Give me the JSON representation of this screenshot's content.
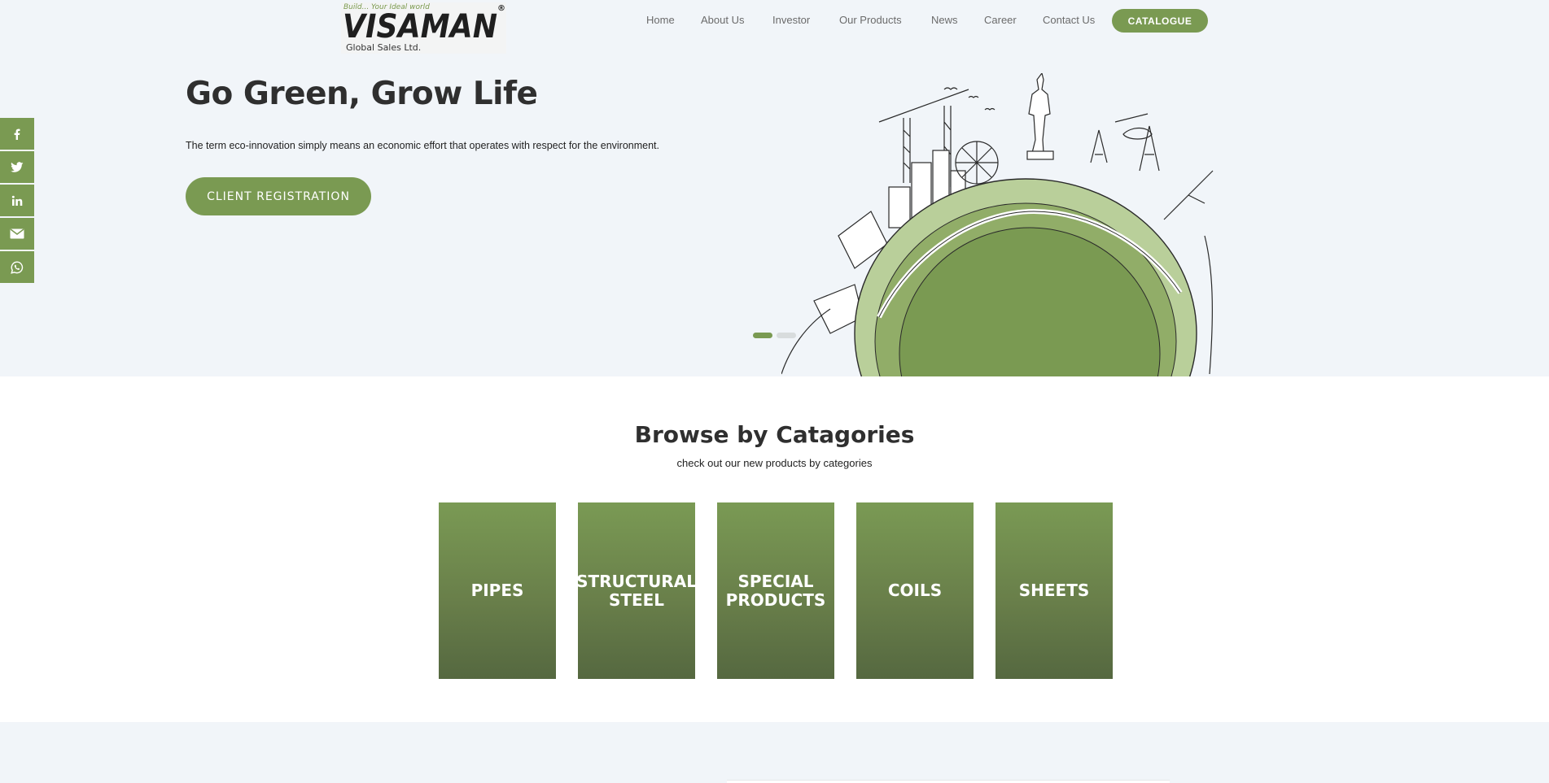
{
  "logo": {
    "tagline": "Build... Your Ideal world",
    "wordmark": "VISAMAN",
    "subtitle": "Global Sales Ltd.",
    "reg_mark": "®"
  },
  "nav": {
    "items": [
      "Home",
      "About Us",
      "Investor",
      "Our Products",
      "News",
      "Career",
      "Contact Us"
    ],
    "catalogue_label": "CATALOGUE"
  },
  "social": {
    "icons": [
      "facebook-icon",
      "twitter-icon",
      "linkedin-icon",
      "email-icon",
      "whatsapp-icon"
    ]
  },
  "hero": {
    "title": "Go Green, Grow Life",
    "text": "The term eco-innovation simply means an economic effort that operates with respect for the environment.",
    "cta_label": "CLIENT REGISTRATION",
    "slides": 2,
    "active_slide": 1
  },
  "categories": {
    "title": "Browse by Catagories",
    "subtitle": "check out our new products by categories",
    "tiles": [
      "PIPES",
      "STRUCTURAL STEEL",
      "SPECIAL PRODUCTS",
      "COILS",
      "SHEETS"
    ]
  },
  "colors": {
    "accent": "#7a9a52",
    "background": "#f1f5f9",
    "heading": "#2f2f2f"
  }
}
